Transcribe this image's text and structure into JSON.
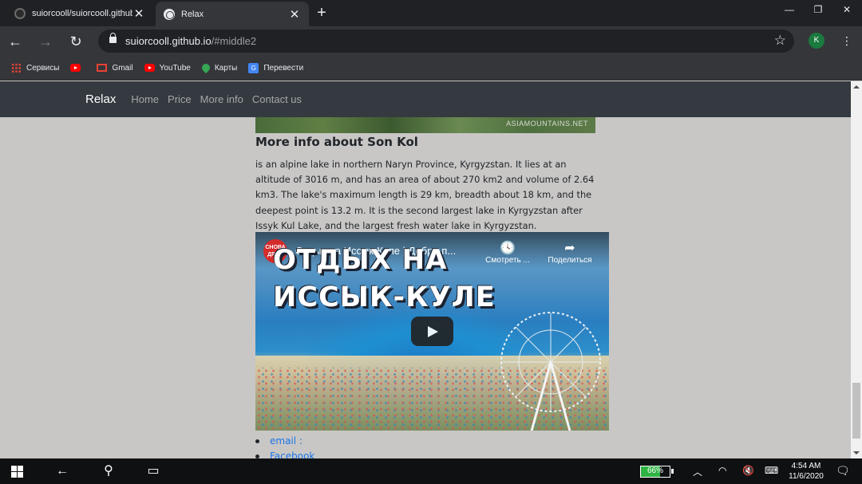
{
  "tabs": [
    {
      "title": "suiorcooll/suiorcooll.github.io",
      "active": false
    },
    {
      "title": "Relax",
      "active": true
    }
  ],
  "omnibox": {
    "host": "suiorcooll.github.io",
    "path": "/#middle2"
  },
  "profile_initial": "K",
  "bookmarks": [
    {
      "label": "Сервисы",
      "icon": "apps-icon"
    },
    {
      "label": "",
      "icon": "youtube-icon"
    },
    {
      "label": "Gmail",
      "icon": "gmail-icon"
    },
    {
      "label": "YouTube",
      "icon": "youtube-icon"
    },
    {
      "label": "Карты",
      "icon": "maps-icon"
    },
    {
      "label": "Перевести",
      "icon": "translate-icon"
    }
  ],
  "site": {
    "brand": "Relax",
    "nav": [
      "Home",
      "Price",
      "More info",
      "Contact us"
    ],
    "photo_watermark": "ASIAMOUNTAINS.NET",
    "heading": "More info about Son Kol",
    "paragraph": "is an alpine lake in northern Naryn Province, Kyrgyzstan. It lies at an altitude of 3016 m, and has an area of about 270 km2 and volume of 2.64 km3. The lake's maximum length is 29 km, breadth about 18 km, and the deepest point is 13.2 m. It is the second largest lake in Kyrgyzstan after Issyk Kul Lake, and the largest fresh water lake in Kyrgyzstan.",
    "video": {
      "channel_logo_text": "СНОВА ДРОЕ",
      "title": "Отдых на Иссык-Куле | Добро п...",
      "watch_later": "Смотреть ...",
      "share": "Поделиться",
      "overlay_line1": "ОТДЫХ НА",
      "overlay_line2": "ИССЫК-КУЛЕ"
    },
    "links": [
      "email :",
      "Facebook"
    ]
  },
  "taskbar": {
    "battery": "66%",
    "battery_level": 0.66,
    "time": "4:54 AM",
    "date": "11/6/2020"
  }
}
